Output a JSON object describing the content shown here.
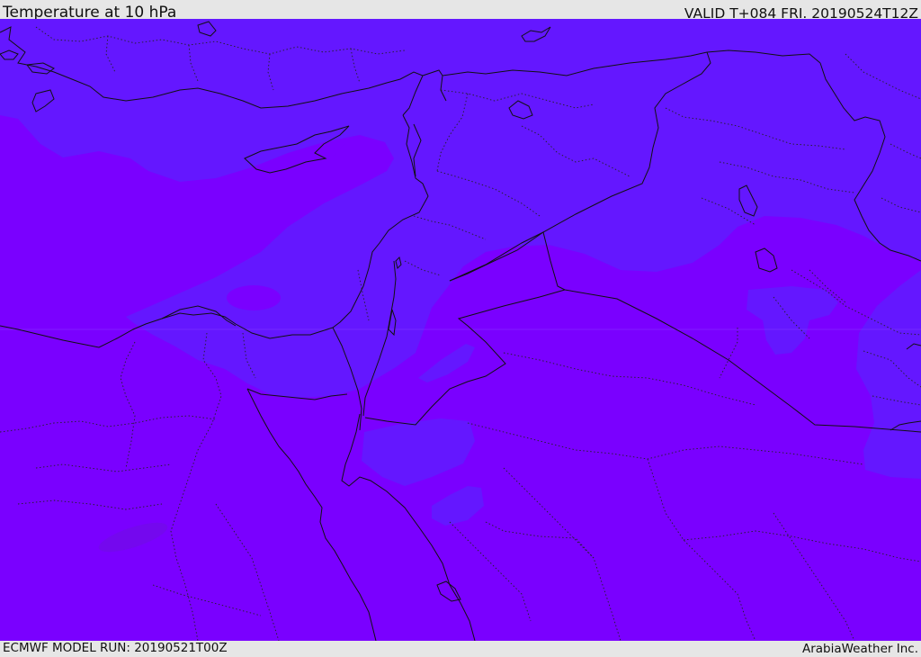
{
  "header": {
    "title": "Temperature at 10 hPa",
    "valid": "VALID T+084 FRI. 20190524T12Z"
  },
  "footer": {
    "model_run": "ECMWF MODEL RUN: 20190521T00Z",
    "credit": "ArabiaWeather Inc."
  },
  "map": {
    "field": "temperature",
    "level_hpa": 10,
    "colors": {
      "warmer_fill": "#7a00ff",
      "cooler_fill": "#6417ff",
      "warmest_patch": "#7408ee",
      "boundary": "#111111",
      "border_dotted": "#222222"
    }
  }
}
